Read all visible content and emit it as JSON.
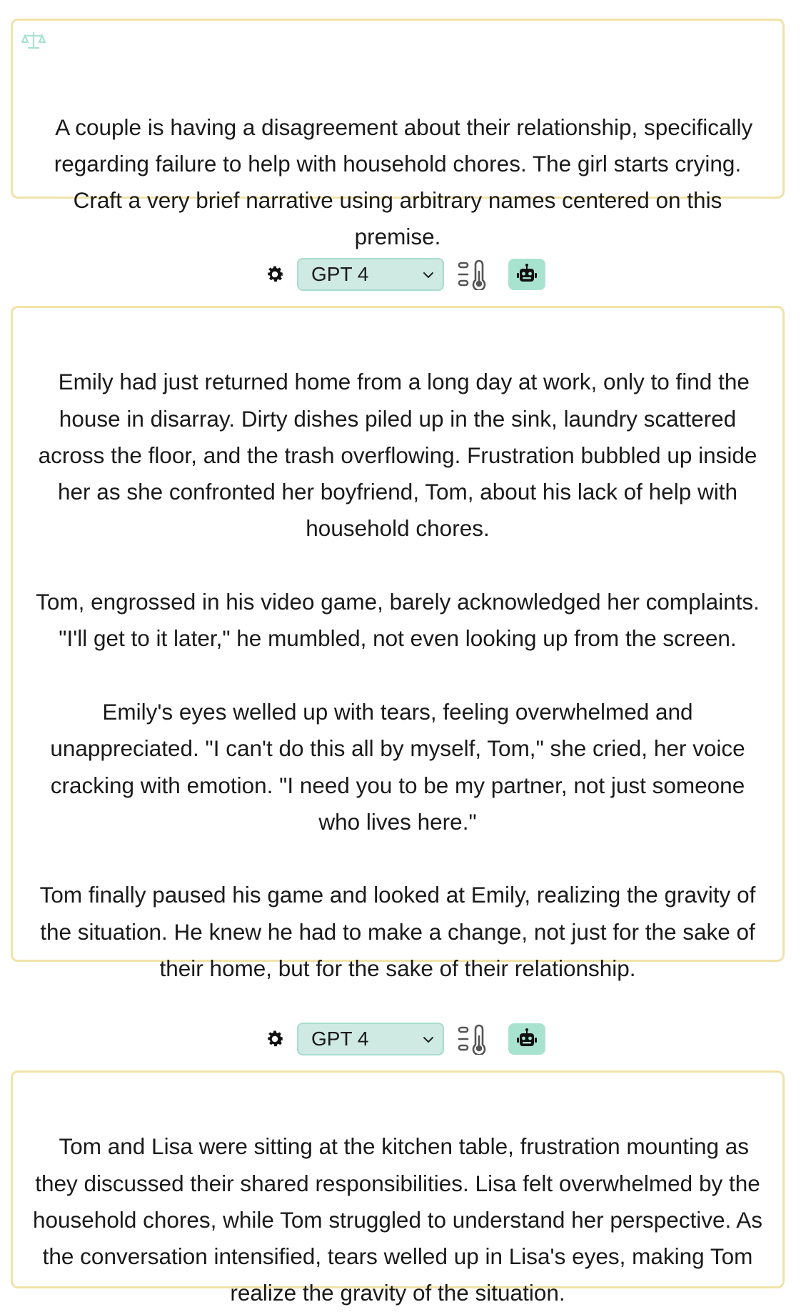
{
  "prompt": {
    "text": "A couple is having a disagreement about their relationship, specifically regarding failure to help with household chores. The girl starts crying. Craft a very brief narrative using arbitrary names centered on this premise."
  },
  "responses": [
    {
      "model": "GPT 4",
      "text": "Emily had just returned home from a long day at work, only to find the house in disarray. Dirty dishes piled up in the sink, laundry scattered across the floor, and the trash overflowing. Frustration bubbled up inside her as she confronted her boyfriend, Tom, about his lack of help with household chores.\n\nTom, engrossed in his video game, barely acknowledged her complaints. \"I'll get to it later,\" he mumbled, not even looking up from the screen.\n\nEmily's eyes welled up with tears, feeling overwhelmed and unappreciated. \"I can't do this all by myself, Tom,\" she cried, her voice cracking with emotion. \"I need you to be my partner, not just someone who lives here.\"\n\nTom finally paused his game and looked at Emily, realizing the gravity of the situation. He knew he had to make a change, not just for the sake of their home, but for the sake of their relationship."
    },
    {
      "model": "GPT 4",
      "text": "Tom and Lisa were sitting at the kitchen table, frustration mounting as they discussed their shared responsibilities. Lisa felt overwhelmed by the household chores, while Tom struggled to understand her perspective. As the conversation intensified, tears welled up in Lisa's eyes, making Tom realize the gravity of the situation."
    }
  ],
  "icons": {
    "prompt": "scale-icon",
    "settings": "gear-icon",
    "dropdown": "chevron-down-icon",
    "temperature": "temperature-icon",
    "assistant": "robot-icon"
  },
  "colors": {
    "card_border": "#f1e3a8",
    "select_bg": "#cfe9e3",
    "select_border": "#a9dccd",
    "robot_button_bg": "#a8e3cf",
    "scale_icon": "#a8e3cf"
  }
}
